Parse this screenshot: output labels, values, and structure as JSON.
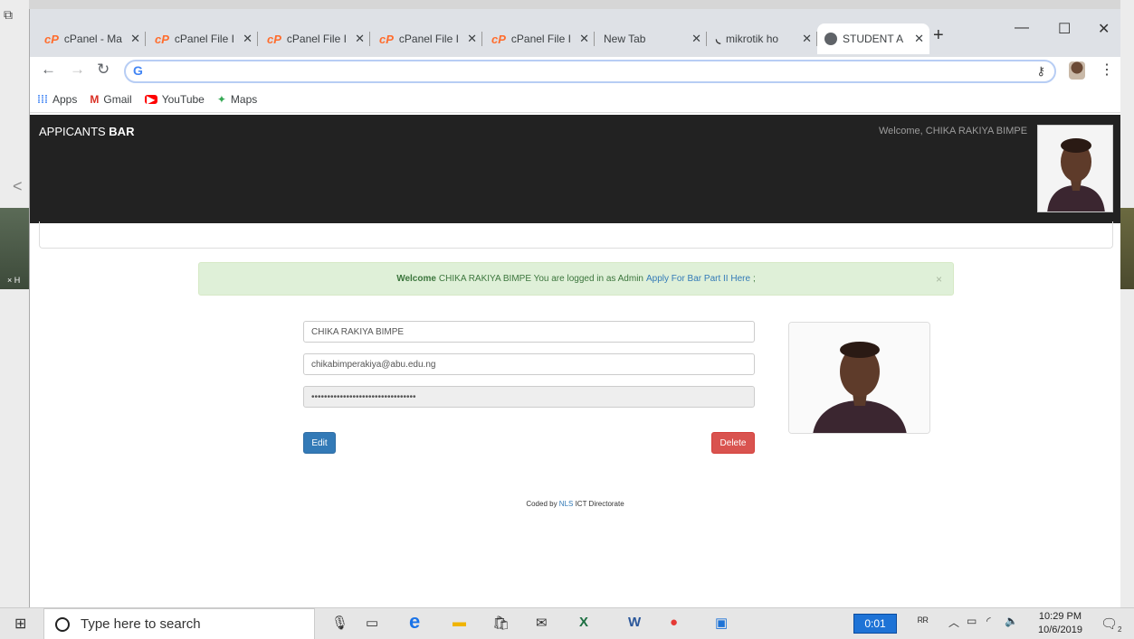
{
  "tabs": [
    {
      "title": "cPanel - Ma",
      "icon": "cpanel-icon"
    },
    {
      "title": "cPanel File I",
      "icon": "cpanel-icon"
    },
    {
      "title": "cPanel File I",
      "icon": "cpanel-icon"
    },
    {
      "title": "cPanel File I",
      "icon": "cpanel-icon"
    },
    {
      "title": "cPanel File I",
      "icon": "cpanel-icon"
    },
    {
      "title": "New Tab",
      "icon": ""
    },
    {
      "title": "mikrotik ho",
      "icon": "mikrotik-icon"
    },
    {
      "title": "STUDENT A",
      "icon": "globe-icon"
    }
  ],
  "bookmarks": [
    "Apps",
    "Gmail",
    "YouTube",
    "Maps"
  ],
  "header": {
    "brand_prefix": "APPICANTS ",
    "brand_bold": "BAR",
    "welcome": "Welcome, CHIKA RAKIYA BIMPE"
  },
  "alert": {
    "bold": "Welcome",
    "text": "CHIKA RAKIYA BIMPE You are logged in as Admin",
    "link": "Apply For Bar Part II Here",
    "suffix": ";",
    "close": "×"
  },
  "form": {
    "name": "CHIKA RAKIYA BIMPE",
    "email": "chikabimperakiya@abu.edu.ng",
    "password_mask": "•••••••••••••••••••••••••••••••••",
    "edit_label": "Edit",
    "delete_label": "Delete"
  },
  "footer": {
    "prefix": "Coded by ",
    "org": "NLS",
    "suffix": " ICT Directorate"
  },
  "taskbar": {
    "search_placeholder": "Type here to search",
    "timer": "0:01",
    "time": "10:29 PM",
    "date": "10/6/2019",
    "notifications": "2"
  },
  "colors": {
    "header_bg": "#222222",
    "alert_bg": "#dff0d8",
    "edit_btn": "#337ab7",
    "delete_btn": "#d9534f"
  }
}
